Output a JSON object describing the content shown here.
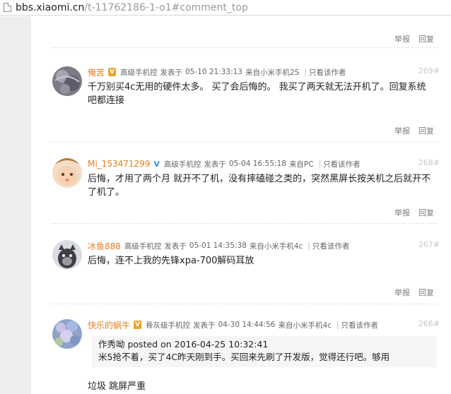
{
  "browser": {
    "url_domain": "bbs.xiaomi.cn",
    "url_path": "/t-11762186-1-o1#comment_top"
  },
  "labels": {
    "report": "举报",
    "reply": "回复",
    "posted_prefix": "发表于",
    "only_author": "只看该作者"
  },
  "posts": [
    {
      "username": "俺苦",
      "badge": "V",
      "level": "高级手机控",
      "time": "05-10 21:33:13",
      "source": "来自小米手机2S",
      "floor": "269#",
      "text": "千万别买4c无用的硬件太多。 买了会后悔的。 我买了两天就无法开机了。回复系统吧都连接"
    },
    {
      "username": "Mi_153471299",
      "badge": "V",
      "level": "高级手机控",
      "time": "05-04 16:55:18",
      "source": "来自PC",
      "floor": "268#",
      "text": "后悔，才用了两个月 就开不了机，没有摔磕碰之类的，突然黑屏长按关机之后就开不了机了。"
    },
    {
      "username": "冰鱼888",
      "badge": "",
      "level": "高级手机控",
      "time": "05-01 14:35:38",
      "source": "来自小米手机4c",
      "floor": "267#",
      "text": "后悔，连不上我的先锋xpa-700解码耳放"
    },
    {
      "username": "快乐的蜗牛",
      "badge": "V",
      "level": "骨灰级手机控",
      "time": "04-30 14:44:56",
      "source": "来自小米手机4c",
      "floor": "266#",
      "quote_line1": "作秀呦 posted on 2016-04-25 10:32:41",
      "quote_line2": "米5抢不着，买了4C昨天刚到手。买回来先刷了开发版，觉得还行吧。够用",
      "text": "垃圾 跳屏严重"
    }
  ]
}
